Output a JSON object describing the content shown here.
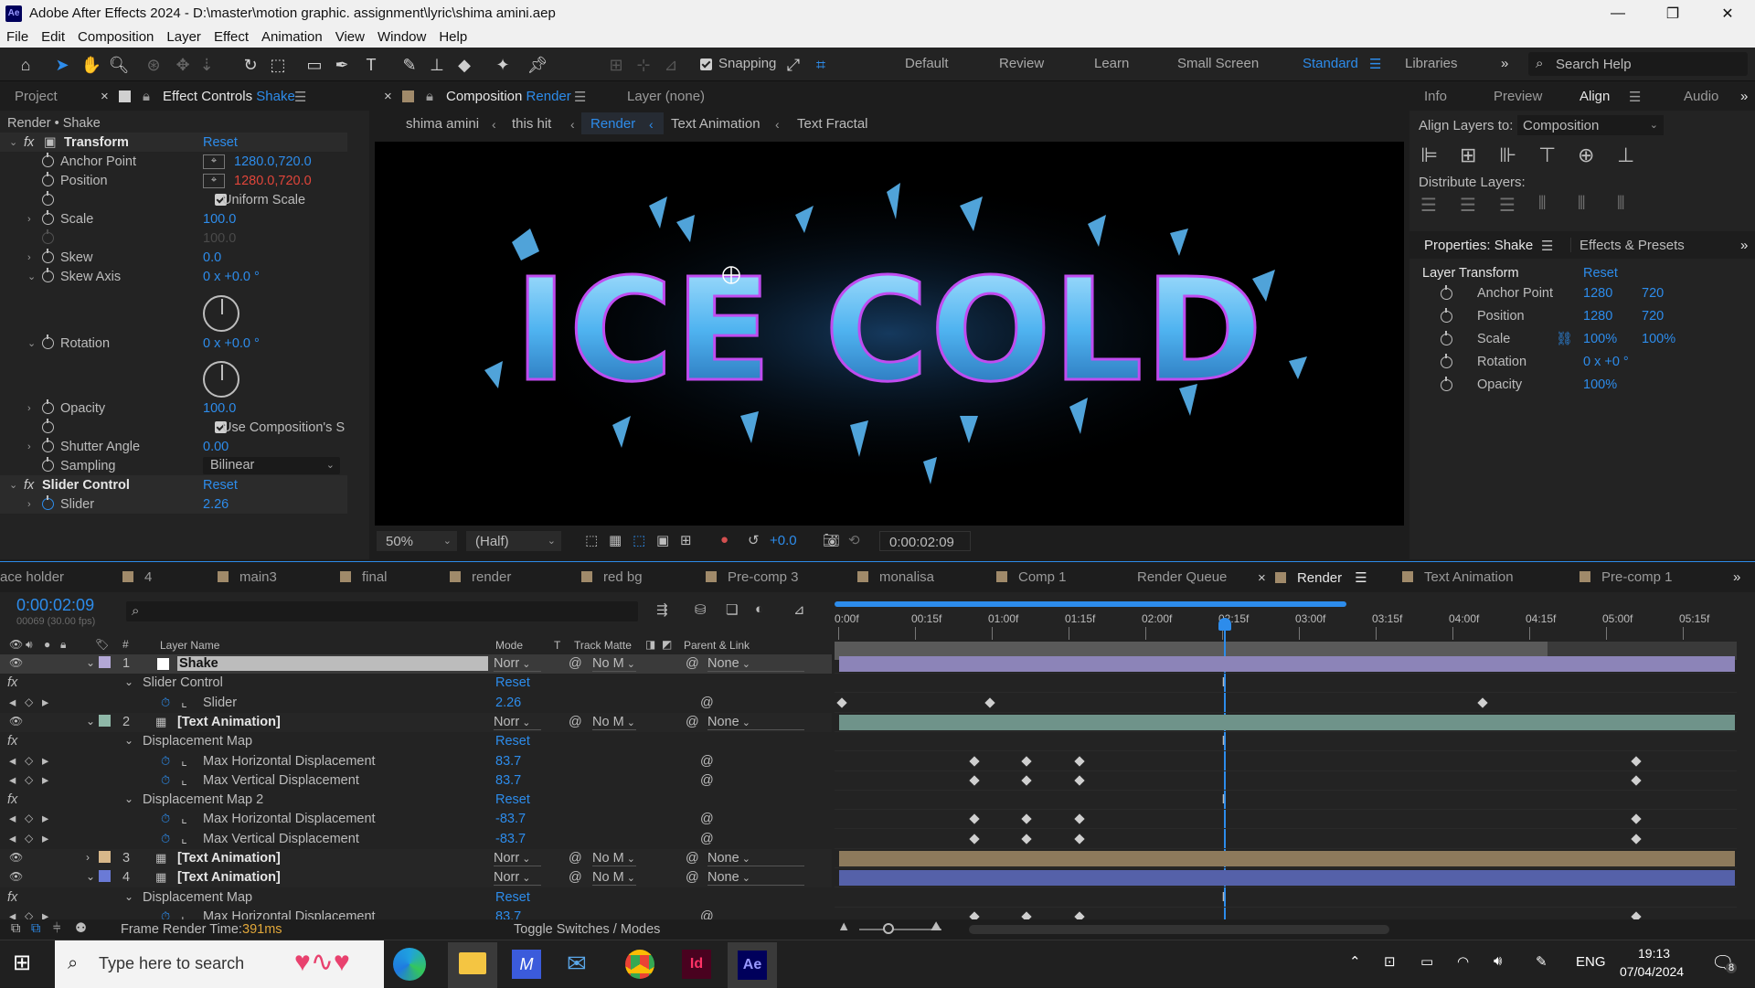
{
  "app": {
    "icon_label": "Ae",
    "title": "Adobe After Effects 2024 - D:\\master\\motion graphic. assignment\\lyric\\shima amini.aep",
    "minimize": "—",
    "restore": "❐",
    "close": "✕"
  },
  "menu": [
    "File",
    "Edit",
    "Composition",
    "Layer",
    "Effect",
    "Animation",
    "View",
    "Window",
    "Help"
  ],
  "toolbar": {
    "snapping_label": "Snapping",
    "workspaces": [
      "Default",
      "Review",
      "Learn",
      "Small Screen",
      "Standard",
      "Libraries"
    ],
    "active_workspace": "Standard",
    "search_placeholder": "Search Help"
  },
  "effect_controls": {
    "tab_project": "Project",
    "tab_label": "Effect Controls",
    "tab_layer": "Shake",
    "breadcrumb": "Render • Shake",
    "transform": {
      "title": "Transform",
      "reset": "Reset",
      "anchor_point_label": "Anchor Point",
      "anchor_point_value": "1280.0,720.0",
      "position_label": "Position",
      "position_value": "1280.0,720.0",
      "uniform_scale_label": "Uniform Scale",
      "scale_label": "Scale",
      "scale_value": "100.0",
      "scale_height_value": "100.0",
      "skew_label": "Skew",
      "skew_value": "0.0",
      "skew_axis_label": "Skew Axis",
      "skew_axis_value": "0 x +0.0 °",
      "rotation_label": "Rotation",
      "rotation_value": "0 x +0.0 °",
      "opacity_label": "Opacity",
      "opacity_value": "100.0",
      "use_comp_label": "Use Composition's S",
      "shutter_angle_label": "Shutter Angle",
      "shutter_angle_value": "0.00",
      "sampling_label": "Sampling",
      "sampling_value": "Bilinear"
    },
    "slider_control": {
      "title": "Slider Control",
      "reset": "Reset",
      "slider_label": "Slider",
      "slider_value": "2.26"
    }
  },
  "composition": {
    "tab_label": "Composition",
    "tab_name": "Render",
    "layer_tab": "Layer  (none)",
    "breadcrumbs": [
      "shima amini",
      "this hit",
      "Render",
      "Text Animation",
      "Text Fractal"
    ],
    "active_breadcrumb": "Render",
    "artwork_text": "ICE COLD",
    "zoom": "50%",
    "resolution": "(Half)",
    "exposure": "+0.0",
    "timecode": "0:00:02:09"
  },
  "right_panel": {
    "tabs": [
      "Info",
      "Preview",
      "Align",
      "Audio"
    ],
    "active_tab": "Align",
    "align_layers_to_label": "Align Layers to:",
    "align_layers_to_value": "Composition",
    "distribute_label": "Distribute Layers:",
    "props_tab": "Properties: Shake",
    "effects_tab": "Effects & Presets",
    "layer_transform_label": "Layer Transform",
    "reset": "Reset",
    "props": [
      {
        "label": "Anchor Point",
        "v1": "1280",
        "v2": "720"
      },
      {
        "label": "Position",
        "v1": "1280",
        "v2": "720"
      },
      {
        "label": "Scale",
        "v1": "100%",
        "v2": "100%"
      },
      {
        "label": "Rotation",
        "v1": "0 x +0 °",
        "v2": ""
      },
      {
        "label": "Opacity",
        "v1": "100%",
        "v2": ""
      }
    ]
  },
  "timeline": {
    "tabs": [
      {
        "label": "ace holder",
        "color": ""
      },
      {
        "label": "4",
        "color": "#a08a6a"
      },
      {
        "label": "main3",
        "color": "#a08a6a"
      },
      {
        "label": "final",
        "color": "#a08a6a"
      },
      {
        "label": "render",
        "color": "#a08a6a"
      },
      {
        "label": "red bg",
        "color": "#a08a6a"
      },
      {
        "label": "Pre-comp 3",
        "color": "#a08a6a"
      },
      {
        "label": "monalisa",
        "color": "#a08a6a"
      },
      {
        "label": "Comp 1",
        "color": "#a08a6a"
      },
      {
        "label": "Render Queue",
        "color": ""
      },
      {
        "label": "Render",
        "color": "#a08a6a"
      },
      {
        "label": "Text Animation",
        "color": "#a08a6a"
      },
      {
        "label": "Pre-comp 1",
        "color": "#a08a6a"
      }
    ],
    "active_tab": "Render",
    "timecode": "0:00:02:09",
    "frame_info": "00069 (30.00 fps)",
    "headers": {
      "layer_name": "Layer Name",
      "mode": "Mode",
      "t": "T",
      "track_matte": "Track Matte",
      "parent": "Parent & Link"
    },
    "ruler_labels": [
      "0:00f",
      "00:15f",
      "01:00f",
      "01:15f",
      "02:00f",
      "02:15f",
      "03:00f",
      "03:15f",
      "04:00f",
      "04:15f",
      "05:00f",
      "05:15f"
    ],
    "playhead_fraction": 0.432,
    "work_area_end_fraction": 0.79,
    "layers": [
      {
        "num": "1",
        "name": "Shake",
        "color": "#b3a8d6",
        "mode": "Norr",
        "matte": "No M",
        "parent": "None",
        "bar": "#8c84b8"
      },
      {
        "num": "2",
        "name": "[Text Animation]",
        "color": "#8fb8a8",
        "mode": "Norr",
        "matte": "No M",
        "parent": "None",
        "bar": "#6f938a"
      },
      {
        "num": "3",
        "name": "[Text Animation]",
        "color": "#d8b88a",
        "mode": "Norr",
        "matte": "No M",
        "parent": "None",
        "bar": "#8d7a5c"
      },
      {
        "num": "4",
        "name": "[Text Animation]",
        "color": "#6a7ad6",
        "mode": "Norr",
        "matte": "No M",
        "parent": "None",
        "bar": "#5561a9"
      }
    ],
    "props": {
      "slider_control": "Slider Control",
      "slider": "Slider",
      "slider_value": "2.26",
      "disp_map": "Displacement Map",
      "disp_map_2": "Displacement Map 2",
      "max_h": "Max Horizontal Displacement",
      "max_v": "Max Vertical Displacement",
      "val_pos": "83.7",
      "val_neg": "-83.7",
      "reset": "Reset"
    },
    "frame_render_label": "Frame Render Time:",
    "frame_render_value": "391ms",
    "toggle_label": "Toggle Switches / Modes"
  },
  "taskbar": {
    "search_placeholder": "Type here to search",
    "language": "ENG",
    "time": "19:13",
    "date": "07/04/2024",
    "notification_count": "8"
  }
}
